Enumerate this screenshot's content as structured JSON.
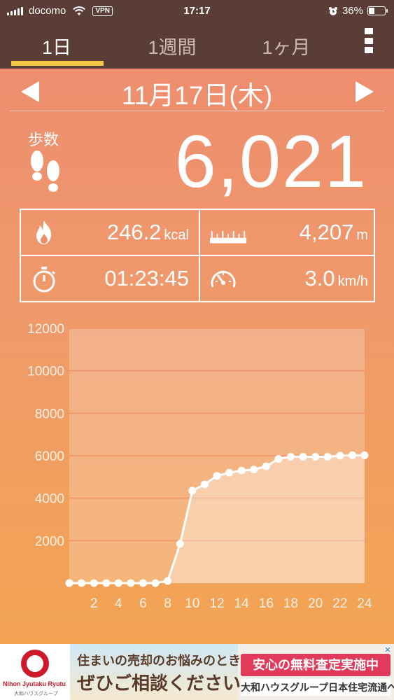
{
  "status_bar": {
    "carrier": "docomo",
    "vpn": "VPN",
    "time": "17:17",
    "battery": "36%",
    "battery_level": 0.36
  },
  "tabs": [
    {
      "label": "1日",
      "active": true
    },
    {
      "label": "1週間",
      "active": false
    },
    {
      "label": "1ヶ月",
      "active": false
    }
  ],
  "date": "11月17日(木)",
  "steps": {
    "label": "歩数",
    "value": "6,021"
  },
  "stats": {
    "calories": {
      "value": "246.2",
      "unit": "kcal"
    },
    "distance": {
      "value": "4,207",
      "unit": "m"
    },
    "duration": {
      "value": "01:23:45"
    },
    "speed": {
      "value": "3.0",
      "unit": "km/h"
    }
  },
  "chart_data": {
    "type": "line",
    "x": [
      0,
      1,
      2,
      3,
      4,
      5,
      6,
      7,
      8,
      9,
      10,
      11,
      12,
      13,
      14,
      15,
      16,
      17,
      18,
      19,
      20,
      21,
      22,
      23,
      24
    ],
    "values": [
      0,
      0,
      0,
      0,
      0,
      0,
      0,
      0,
      100,
      1850,
      4350,
      4650,
      5050,
      5200,
      5300,
      5350,
      5500,
      5850,
      5950,
      5950,
      5950,
      5950,
      6000,
      6020,
      6021
    ],
    "xticks": [
      "2",
      "4",
      "6",
      "8",
      "10",
      "12",
      "14",
      "16",
      "18",
      "20",
      "22",
      "24"
    ],
    "yticks": [
      "2000",
      "4000",
      "6000",
      "8000",
      "10000",
      "12000"
    ],
    "ylim": [
      0,
      12000
    ],
    "xlim": [
      0,
      24
    ],
    "grid": true
  },
  "ad": {
    "brand": "Nihon Jyutaku Ryutu",
    "brand_sub": "大和ハウスグループ",
    "line1": "住まいの売却のお悩みのときは",
    "line2": "ぜひご相談ください",
    "badge": "安心の無料査定実施中",
    "line3": "大和ハウスグループ日本住宅流通へ",
    "close": "✕"
  }
}
